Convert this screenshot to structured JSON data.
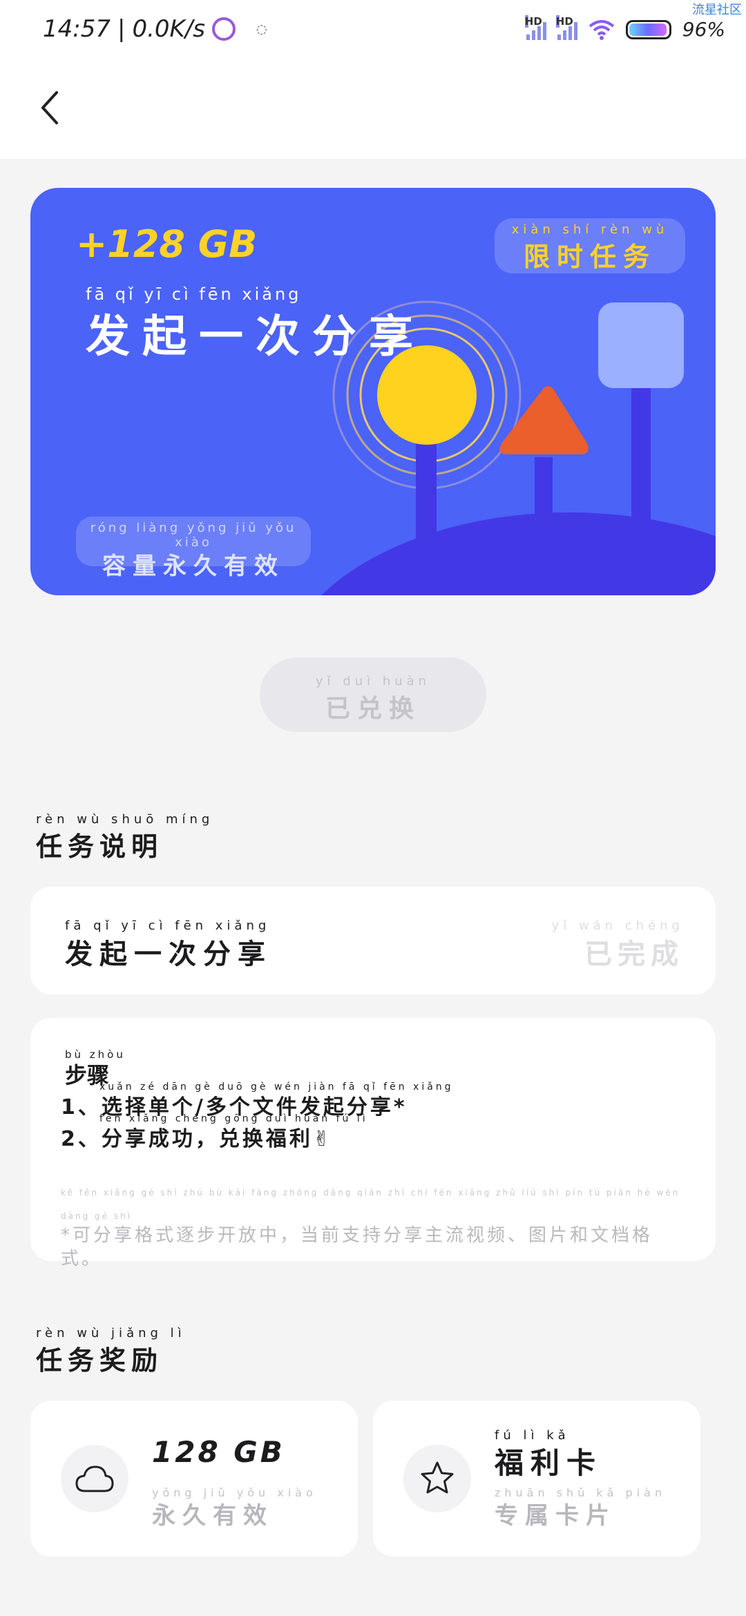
{
  "status_bar": {
    "time": "14:57",
    "net_speed": "0.0K/s",
    "battery": "96%",
    "network_label_1": "HD",
    "network_label_2": "HD",
    "watermark": "流星社区"
  },
  "banner": {
    "amount": "+128 GB",
    "title_pinyin": "fā qǐ yī cì fēn xiǎng",
    "title": "发起一次分享",
    "limited_pinyin": "xiàn shí rèn wù",
    "limited": "限时任务",
    "permanent_pinyin": "róng liàng yǒng jiǔ yǒu xiào",
    "permanent": "容量永久有效",
    "colors": {
      "background": "#4b63f7",
      "accent": "#ffd326"
    }
  },
  "redeem_button": {
    "pinyin": "yǐ duì huàn",
    "label": "已兑换"
  },
  "task_description": {
    "heading_pinyin": "rèn wù shuō míng",
    "heading": "任务说明",
    "task_pinyin": "fā qǐ yī cì fēn xiǎng",
    "task_name": "发起一次分享",
    "status_pinyin": "yǐ wán chéng",
    "status": "已完成"
  },
  "steps": {
    "heading_pinyin": "bù zhòu",
    "heading": "步骤",
    "step1_pinyin": "xuǎn zé dān gè duō gè wén jiàn fā qǐ fēn xiǎng",
    "step1": "1、选择单个/多个文件发起分享*",
    "step2_pinyin": "fēn xiǎng chéng gōng duì huàn fú lì",
    "step2": "2、分享成功，兑换福利✌",
    "note_pinyin": "kě fēn xiǎng gé shì zhú bù kāi fàng zhōng dāng qián zhī chí fēn xiǎng zhǔ liú shì pín tú piān hé wén dàng gé shì",
    "note": "*可分享格式逐步开放中，当前支持分享主流视频、图片和文档格式。"
  },
  "rewards": {
    "heading_pinyin": "rèn wù jiǎng lì",
    "heading": "任务奖励",
    "items": [
      {
        "icon": "cloud-icon",
        "title": "128 GB",
        "title_pinyin": "",
        "sub_pinyin": "yǒng jiǔ yǒu xiào",
        "subtitle": "永久有效"
      },
      {
        "icon": "star-icon",
        "title": "福利卡",
        "title_pinyin": "fú lì kǎ",
        "sub_pinyin": "zhuān shǔ kǎ piàn",
        "subtitle": "专属卡片"
      }
    ]
  }
}
